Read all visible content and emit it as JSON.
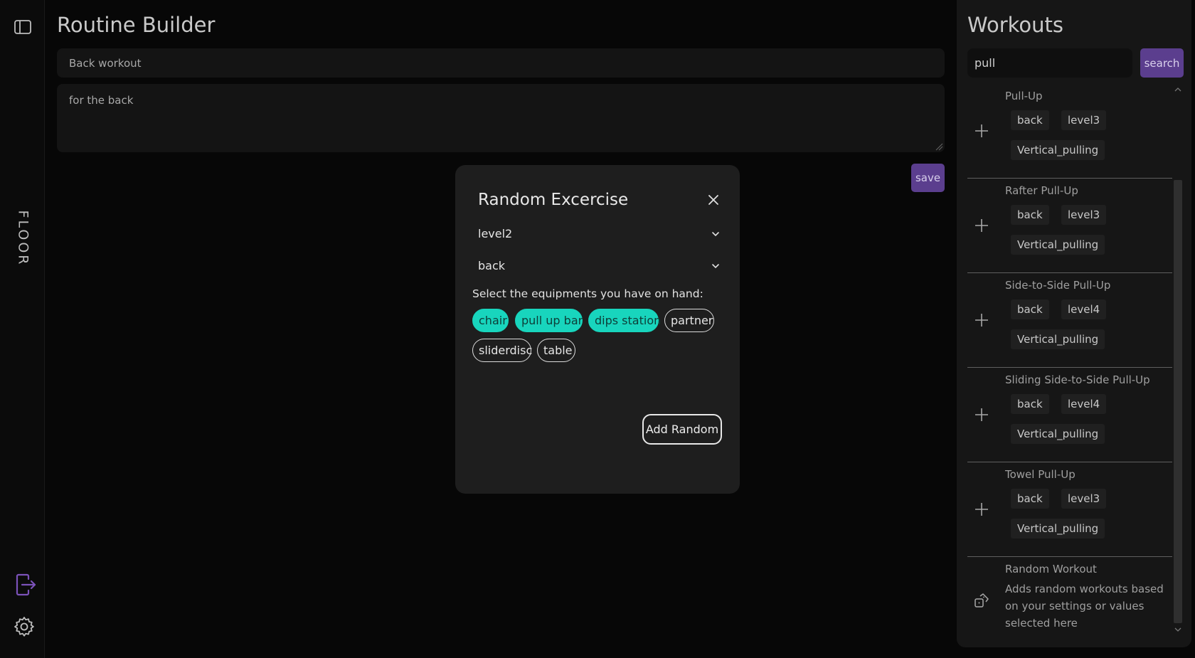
{
  "sidebar": {
    "brand": "FLOOR",
    "icons": {
      "toggle": "sidebar-toggle-icon",
      "logout": "logout-icon",
      "settings": "gear-icon"
    },
    "logout_color": "#7b52b9"
  },
  "builder": {
    "title": "Routine Builder",
    "name_value": "Back workout",
    "description_value": "for the back",
    "save_label": "save"
  },
  "workouts": {
    "title": "Workouts",
    "search_value": "pull",
    "search_label": "search",
    "items": [
      {
        "name": "Pull-Up",
        "tags": [
          "back",
          "level3",
          "Vertical_pulling"
        ]
      },
      {
        "name": "Rafter Pull-Up",
        "tags": [
          "back",
          "level3",
          "Vertical_pulling"
        ]
      },
      {
        "name": "Side-to-Side Pull-Up",
        "tags": [
          "back",
          "level4",
          "Vertical_pulling"
        ]
      },
      {
        "name": "Sliding Side-to-Side Pull-Up",
        "tags": [
          "back",
          "level4",
          "Vertical_pulling"
        ]
      },
      {
        "name": "Towel Pull-Up",
        "tags": [
          "back",
          "level3",
          "Vertical_pulling"
        ]
      }
    ],
    "random": {
      "name": "Random Workout",
      "description": "Adds random workouts based on your settings or values selected here",
      "icon": "dice-icon"
    }
  },
  "modal": {
    "title": "Random Excercise",
    "level_value": "level2",
    "muscle_value": "back",
    "equipment_label": "Select the equipments you have on hand:",
    "equipment": [
      {
        "label": "chair",
        "selected": true
      },
      {
        "label": "pull up bar",
        "selected": true
      },
      {
        "label": "dips station",
        "selected": true
      },
      {
        "label": "partner",
        "selected": false
      },
      {
        "label": "sliderdisc",
        "selected": false
      },
      {
        "label": "table",
        "selected": false
      }
    ],
    "add_label": "Add Random"
  },
  "colors": {
    "accent": "#5b3e8e",
    "chip_selected": "#18d5bd",
    "background": "#070707",
    "panel": "#161616",
    "modal": "#1e1e1e"
  }
}
